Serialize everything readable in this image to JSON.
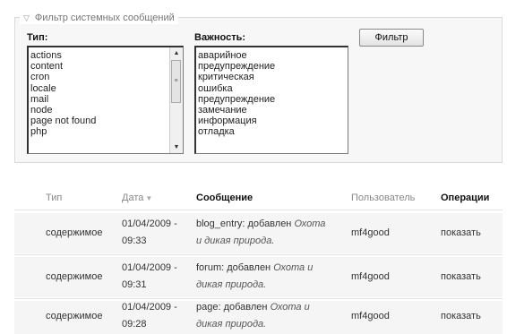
{
  "filter": {
    "legend": "Фильтр системных сообщений",
    "type_label": "Тип:",
    "type_options": [
      "actions",
      "content",
      "cron",
      "locale",
      "mail",
      "node",
      "page not found",
      "php"
    ],
    "severity_label": "Важность:",
    "severity_options": [
      "аварийное",
      "предупреждение",
      "критическая",
      "ошибка",
      "предупреждение",
      "замечание",
      "информация",
      "отладка"
    ],
    "button_label": "Фильтр"
  },
  "table": {
    "headers": {
      "type": "Тип",
      "date": "Дата",
      "message": "Сообщение",
      "user": "Пользователь",
      "operations": "Операции"
    },
    "rows": [
      {
        "type": "содержимое",
        "date_line1": "01/04/2009 -",
        "date_line2": "09:33",
        "msg_prefix": "blog_entry: добавлен",
        "msg_title_1": "Охота",
        "msg_title_2": "и дикая природа.",
        "user": "mf4good",
        "op": "показать"
      },
      {
        "type": "содержимое",
        "date_line1": "01/04/2009 -",
        "date_line2": "09:31",
        "msg_prefix": "forum: добавлен",
        "msg_title_1": "Охота и",
        "msg_title_2": "дикая природа.",
        "user": "mf4good",
        "op": "показать"
      },
      {
        "type": "содержимое",
        "date_line1": "01/04/2009 -",
        "date_line2": "09:28",
        "msg_prefix": "page: добавлен",
        "msg_title_1": "Охота и",
        "msg_title_2": "дикая природа.",
        "user": "mf4good",
        "op": "показать"
      }
    ]
  },
  "colors": {
    "row_bg": "#f5f5f5",
    "header_text": "#888888"
  }
}
